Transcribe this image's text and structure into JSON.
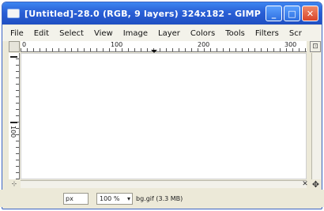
{
  "window": {
    "title": "[Untitled]-28.0 (RGB, 9 layers) 324x182 - GIMP",
    "buttons": {
      "minimize": "_",
      "maximize": "□",
      "close": "✕"
    }
  },
  "menubar": {
    "items": [
      "File",
      "Edit",
      "Select",
      "View",
      "Image",
      "Layer",
      "Colors",
      "Tools",
      "Filters",
      "Scr"
    ]
  },
  "ruler": {
    "h_labels": [
      "0",
      "100",
      "200",
      "300"
    ],
    "v_label": "100"
  },
  "statusbar": {
    "unit": "px",
    "zoom": "100 %",
    "message": "bg.gif (3.3 MB)"
  },
  "icons": {
    "nav": "⊡",
    "quickmask": "⊹",
    "pan": "✥",
    "zoom_close": "✕"
  }
}
